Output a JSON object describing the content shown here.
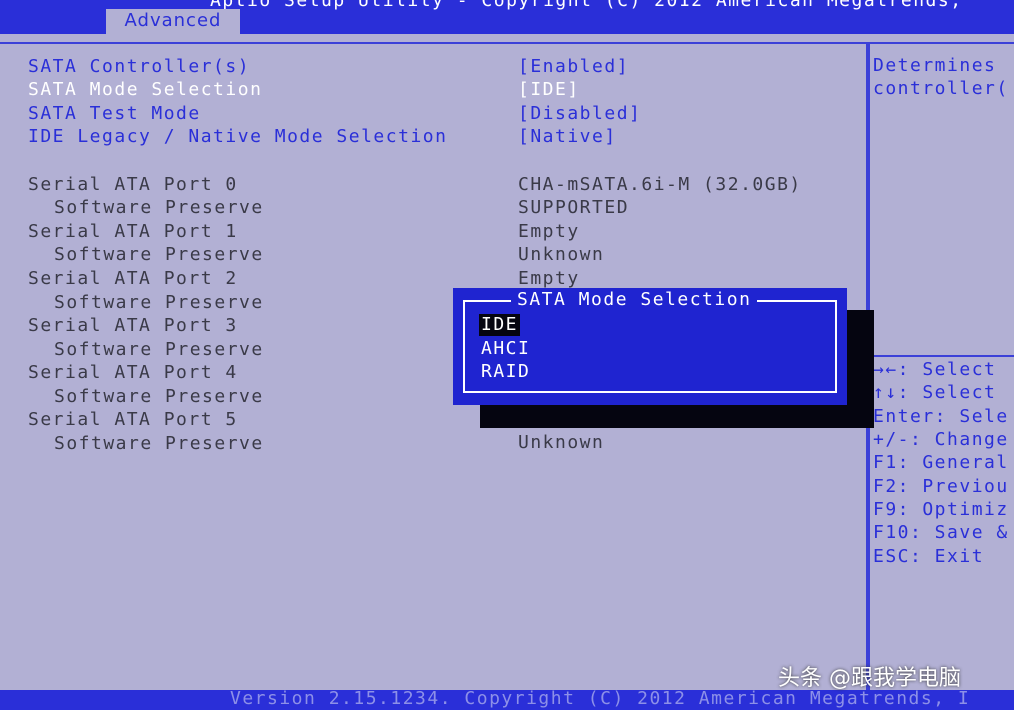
{
  "header": {
    "title": "Aptio Setup Utility - Copyright (C) 2012 American Megatrends,",
    "tab": "Advanced"
  },
  "settings": [
    {
      "label": "SATA Controller(s)",
      "value": "[Enabled]"
    },
    {
      "label": "SATA Mode Selection",
      "value": "[IDE]"
    },
    {
      "label": "SATA Test Mode",
      "value": "[Disabled]"
    },
    {
      "label": "IDE Legacy / Native Mode Selection",
      "value": "[Native]"
    }
  ],
  "ports": [
    {
      "label": "Serial ATA Port 0",
      "value": "CHA-mSATA.6i-M (32.0GB)"
    },
    {
      "label": "Software Preserve",
      "value": "SUPPORTED"
    },
    {
      "label": "Serial ATA Port 1",
      "value": "Empty"
    },
    {
      "label": "Software Preserve",
      "value": "Unknown"
    },
    {
      "label": "Serial ATA Port 2",
      "value": "Empty"
    },
    {
      "label": "Software Preserve",
      "value": ""
    },
    {
      "label": "Serial ATA Port 3",
      "value": ""
    },
    {
      "label": "Software Preserve",
      "value": ""
    },
    {
      "label": "Serial ATA Port 4",
      "value": ""
    },
    {
      "label": "Software Preserve",
      "value": ""
    },
    {
      "label": "Serial ATA Port 5",
      "value": ""
    },
    {
      "label": "Software Preserve",
      "value": "Unknown"
    }
  ],
  "help": {
    "description": [
      "Determines",
      "controller("
    ],
    "keys": [
      "→←: Select",
      "↑↓: Select",
      "Enter: Sele",
      "+/-: Change",
      "F1: General",
      "F2: Previou",
      "F9: Optimiz",
      "F10: Save &",
      "ESC: Exit"
    ]
  },
  "dialog": {
    "title": "SATA Mode Selection",
    "options": [
      "IDE",
      "AHCI",
      "RAID"
    ],
    "selected": "IDE"
  },
  "footer": {
    "text": "Version 2.15.1234. Copyright (C) 2012 American Megatrends, I"
  },
  "watermark": "头条 @跟我学电脑",
  "colors": {
    "background": "#b2b0d4",
    "accent": "#2a2fd8",
    "dialog": "#1f24d0"
  }
}
